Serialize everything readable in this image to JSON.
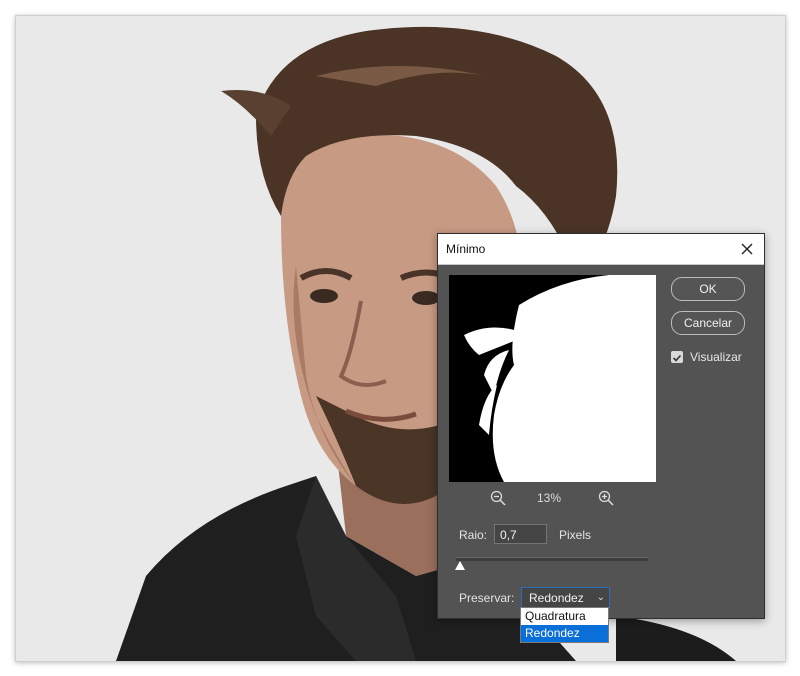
{
  "dialog": {
    "title": "Mínimo",
    "preview_zoom": "13%",
    "ok_label": "OK",
    "cancel_label": "Cancelar",
    "preview_checkbox": {
      "label": "Visualizar",
      "checked": true
    },
    "radius": {
      "label": "Raio:",
      "value": "0,7",
      "unit": "Pixels",
      "slider_fraction": 0.02
    },
    "preserve": {
      "label": "Preservar:",
      "selected": "Redondez",
      "options": [
        "Quadratura",
        "Redondez"
      ]
    }
  },
  "icons": {
    "close": "close-icon",
    "zoom_out": "zoom-out-icon",
    "zoom_in": "zoom-in-icon",
    "checkmark": "checkmark-icon",
    "chevron": "chevron-down-icon"
  },
  "colors": {
    "dialog_bg": "#535353",
    "accent": "#0a6fd8",
    "photo_bg": "#e9e9e9"
  }
}
